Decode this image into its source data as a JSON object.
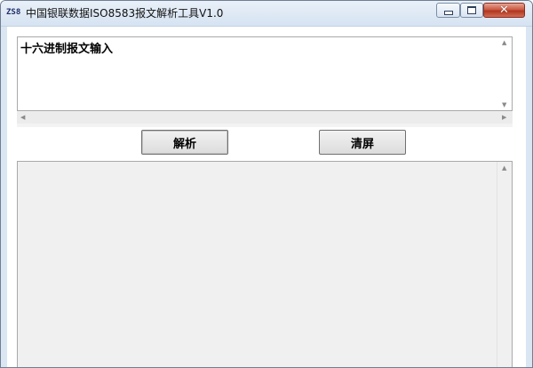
{
  "window": {
    "title": "中国银联数据ISO8583报文解析工具V1.0",
    "app_icon_text": "ZS8",
    "close_glyph": "✕"
  },
  "input": {
    "text": "十六进制报文输入"
  },
  "buttons": {
    "parse_label": "解析",
    "clear_label": "清屏"
  },
  "icons": {
    "app": "zs8-app-icon",
    "minimize": "minimize-icon",
    "maximize": "maximize-icon",
    "close": "close-icon",
    "scroll_up": "triangle-up-icon",
    "scroll_down": "triangle-down-icon",
    "scroll_left": "triangle-left-icon",
    "scroll_right": "triangle-right-icon"
  },
  "colors": {
    "close_button": "#c95a43",
    "titlebar": "#dbe6f3",
    "output_background": "#f0f0f0"
  }
}
